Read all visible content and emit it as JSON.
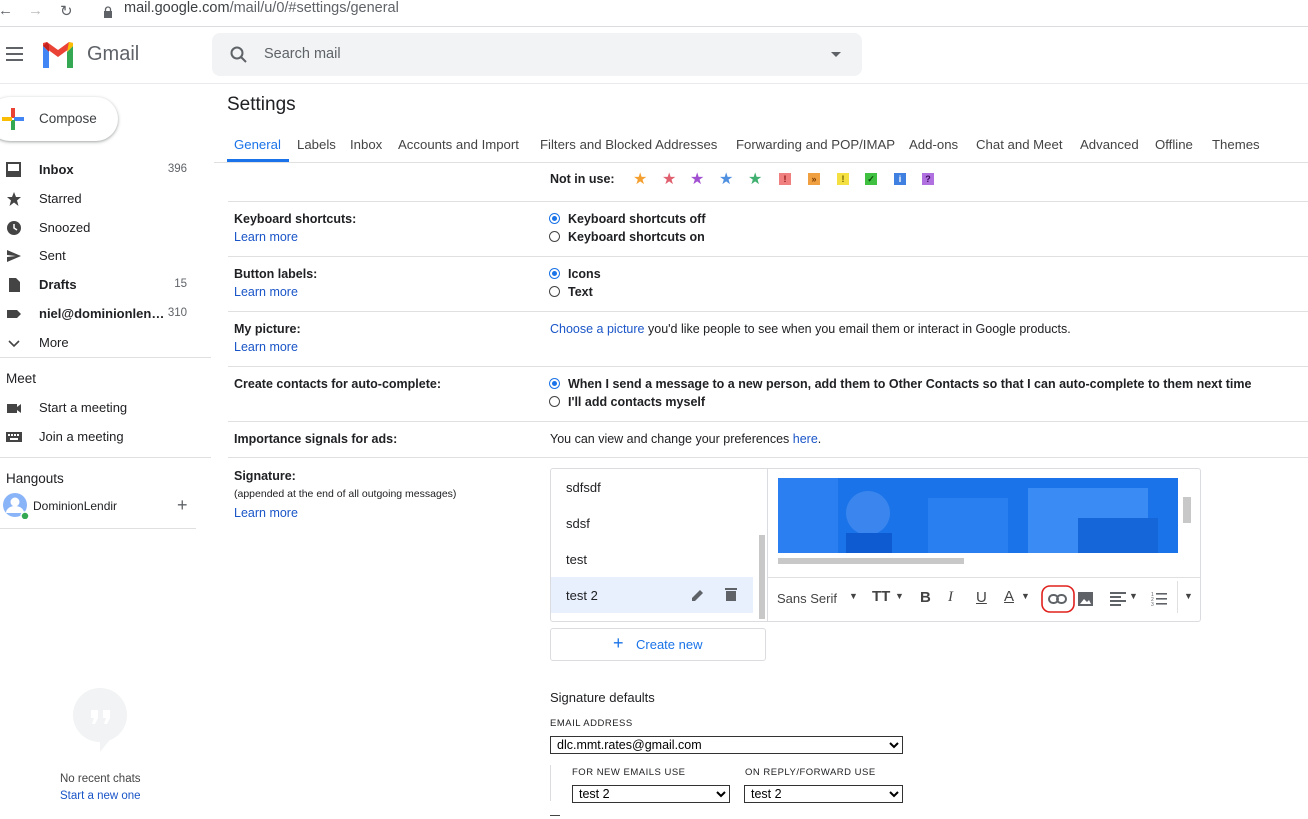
{
  "browser": {
    "url_host": "mail.google.com",
    "url_path": "/mail/u/0/#settings/general"
  },
  "header": {
    "app_name": "Gmail",
    "search_placeholder": "Search mail"
  },
  "sidebar": {
    "compose_label": "Compose",
    "items": [
      {
        "label": "Inbox",
        "count": "396",
        "bold": true,
        "icon": "inbox-icon"
      },
      {
        "label": "Starred",
        "count": "",
        "bold": false,
        "icon": "star-icon"
      },
      {
        "label": "Snoozed",
        "count": "",
        "bold": false,
        "icon": "clock-icon"
      },
      {
        "label": "Sent",
        "count": "",
        "bold": false,
        "icon": "send-icon"
      },
      {
        "label": "Drafts",
        "count": "15",
        "bold": true,
        "icon": "draft-icon"
      },
      {
        "label": "niel@dominionlen…",
        "count": "310",
        "bold": true,
        "icon": "label-icon"
      },
      {
        "label": "More",
        "count": "",
        "bold": false,
        "icon": "chevron-down-icon"
      }
    ],
    "meet": {
      "title": "Meet",
      "start": "Start a meeting",
      "join": "Join a meeting"
    },
    "hangouts": {
      "title": "Hangouts",
      "user": "DominionLendir",
      "no_chats": "No recent chats",
      "start_new": "Start a new one"
    }
  },
  "settings": {
    "title": "Settings",
    "tabs": [
      "General",
      "Labels",
      "Inbox",
      "Accounts and Import",
      "Filters and Blocked Addresses",
      "Forwarding and POP/IMAP",
      "Add-ons",
      "Chat and Meet",
      "Advanced",
      "Offline",
      "Themes"
    ],
    "active_tab": "General",
    "not_in_use_label": "Not in use:",
    "keyboard": {
      "label": "Keyboard shortcuts:",
      "learn_more": "Learn more",
      "opt_off": "Keyboard shortcuts off",
      "opt_on": "Keyboard shortcuts on"
    },
    "button_labels": {
      "label": "Button labels:",
      "learn_more": "Learn more",
      "opt_icons": "Icons",
      "opt_text": "Text"
    },
    "picture": {
      "label": "My picture:",
      "learn_more": "Learn more",
      "link": "Choose a picture",
      "text": " you'd like people to see when you email them or interact in Google products."
    },
    "contacts": {
      "label": "Create contacts for auto-complete:",
      "opt_auto": "When I send a message to a new person, add them to Other Contacts so that I can auto-complete to them next time",
      "opt_self": "I'll add contacts myself"
    },
    "importance": {
      "label": "Importance signals for ads:",
      "text": "You can view and change your preferences ",
      "link": "here",
      "end": "."
    },
    "signature": {
      "label": "Signature:",
      "sub": "(appended at the end of all outgoing messages)",
      "learn_more": "Learn more",
      "list": [
        "sdfsdf",
        "sdsf",
        "test",
        "test 2"
      ],
      "selected": "test 2",
      "font": "Sans Serif",
      "create_new": "Create new",
      "defaults_title": "Signature defaults",
      "email_address_caption": "EMAIL ADDRESS",
      "email_address": "dlc.mmt.rates@gmail.com",
      "new_emails_caption": "FOR NEW EMAILS USE",
      "new_emails_value": "test 2",
      "reply_caption": "ON REPLY/FORWARD USE",
      "reply_value": "test 2"
    }
  },
  "colors": {
    "accent": "#1a73e8",
    "link": "#1a55c8",
    "highlight_circle": "#e0201c"
  }
}
